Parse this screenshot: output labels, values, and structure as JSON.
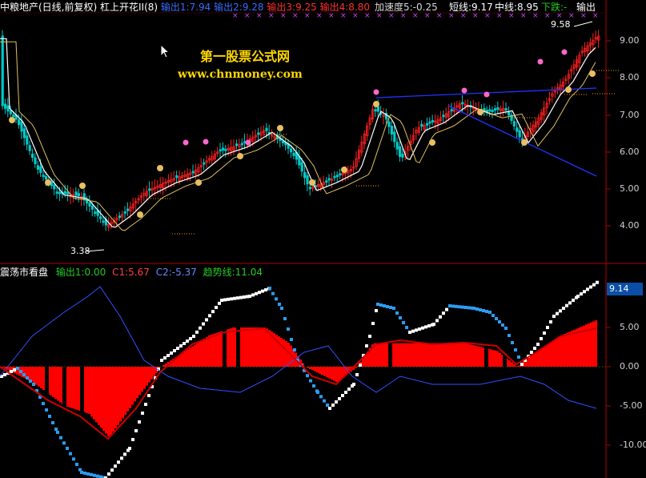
{
  "top_header": {
    "stock": "中粮地产(日线,前复权)",
    "indicator": "杠上开花II(8)",
    "out1": "输出1:7.94",
    "out2": "输出2:9.28",
    "out3": "输出3:9.25",
    "out4": "输出4:8.80",
    "accel": "加速度5:-0.25",
    "short_line": "短线:9.17",
    "mid_line": "中线:8.95",
    "down": "下跌:-",
    "right_out": "输出"
  },
  "watermark": {
    "title": "第一股票公式网",
    "url": "www.chnmoney.com"
  },
  "main_panel": {
    "high_label": "9.58",
    "low_label": "3.38",
    "y_ticks": [
      "9.00",
      "8.00",
      "7.00",
      "6.00",
      "5.00",
      "4.00"
    ]
  },
  "sub_header": {
    "name": "震荡市看盘",
    "out1": "输出1:0.00",
    "c1": "C1:5.67",
    "c2": "C2:-5.37",
    "trend": "趋势线:11.04"
  },
  "sub_panel": {
    "current_value": "9.14",
    "y_ticks": [
      "5.00",
      "0.00",
      "-5.00",
      "-10.00"
    ]
  },
  "colors": {
    "up": "#ff2020",
    "down": "#00c8c8",
    "accent": "#ffd700",
    "blue_line": "#2233ff",
    "hist": "#ff0000",
    "axis": "#b00000"
  }
}
